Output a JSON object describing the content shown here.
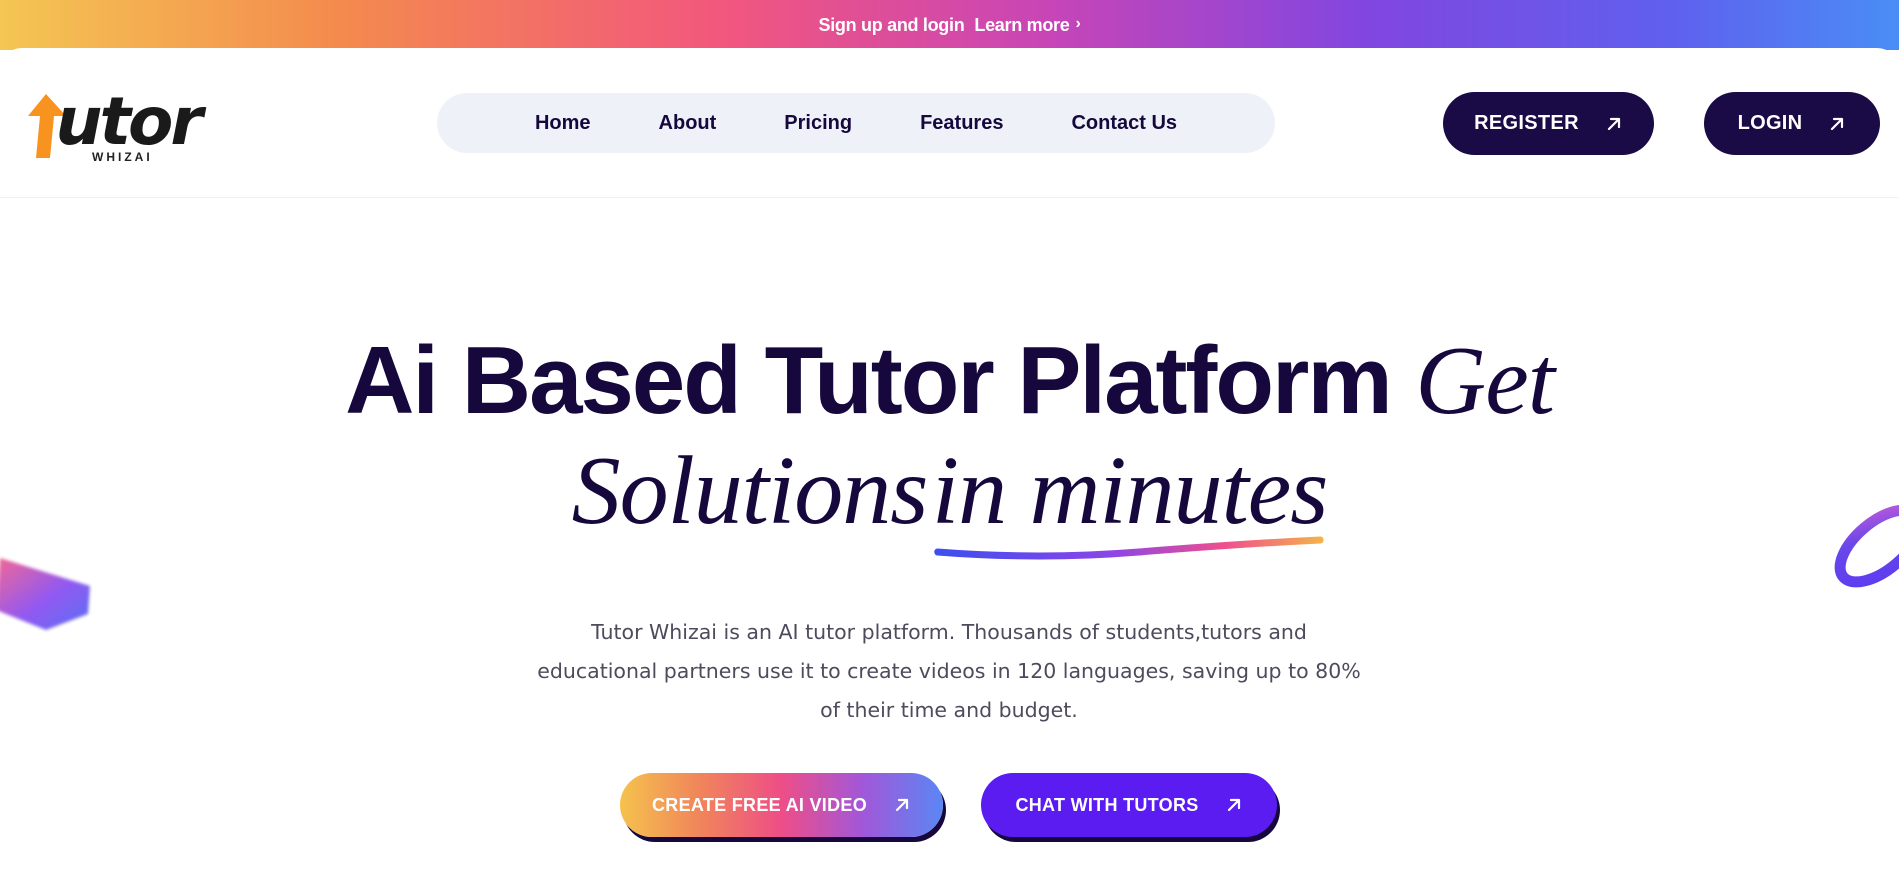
{
  "banner": {
    "signup_text": "Sign up and login",
    "learn_more_text": "Learn more",
    "chevron_glyph": "›"
  },
  "logo": {
    "word": "Tutor",
    "sub": "WHIZAI"
  },
  "nav": {
    "items": [
      {
        "label": "Home"
      },
      {
        "label": "About"
      },
      {
        "label": "Pricing"
      },
      {
        "label": "Features"
      },
      {
        "label": "Contact Us"
      }
    ]
  },
  "header_buttons": {
    "register_label": "REGISTER",
    "login_label": "LOGIN"
  },
  "hero": {
    "title_part1": "Ai Based Tutor Platform",
    "title_part2": "Get",
    "title_part3": "Solutions",
    "title_part4": "in minutes",
    "description": "Tutor Whizai is an AI tutor platform. Thousands of students,tutors and educational partners use it to create videos in 120 languages, saving up to 80% of their time and budget."
  },
  "cta": {
    "create_label": "CREATE FREE AI VIDEO",
    "chat_label": "CHAT WITH TUTORS"
  },
  "colors": {
    "brand_dark": "#16083d",
    "button_dark": "#1a0a45",
    "chat_purple": "#5b1cf2",
    "logo_orange": "#f7931e"
  },
  "icons": {
    "arrow": "arrow-up-right-icon",
    "chevron": "chevron-right-icon"
  }
}
